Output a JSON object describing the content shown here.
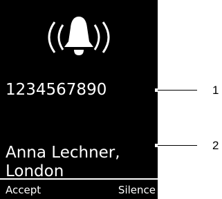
{
  "incoming_call": {
    "alert_icon": "ringing-bell-icon",
    "caller_number": "1234567890",
    "caller_name": "Anna Lechner,\nLondon"
  },
  "softkeys": {
    "left_label": "Accept",
    "right_label": "Silence"
  },
  "callouts": [
    {
      "label": "1"
    },
    {
      "label": "2"
    }
  ]
}
